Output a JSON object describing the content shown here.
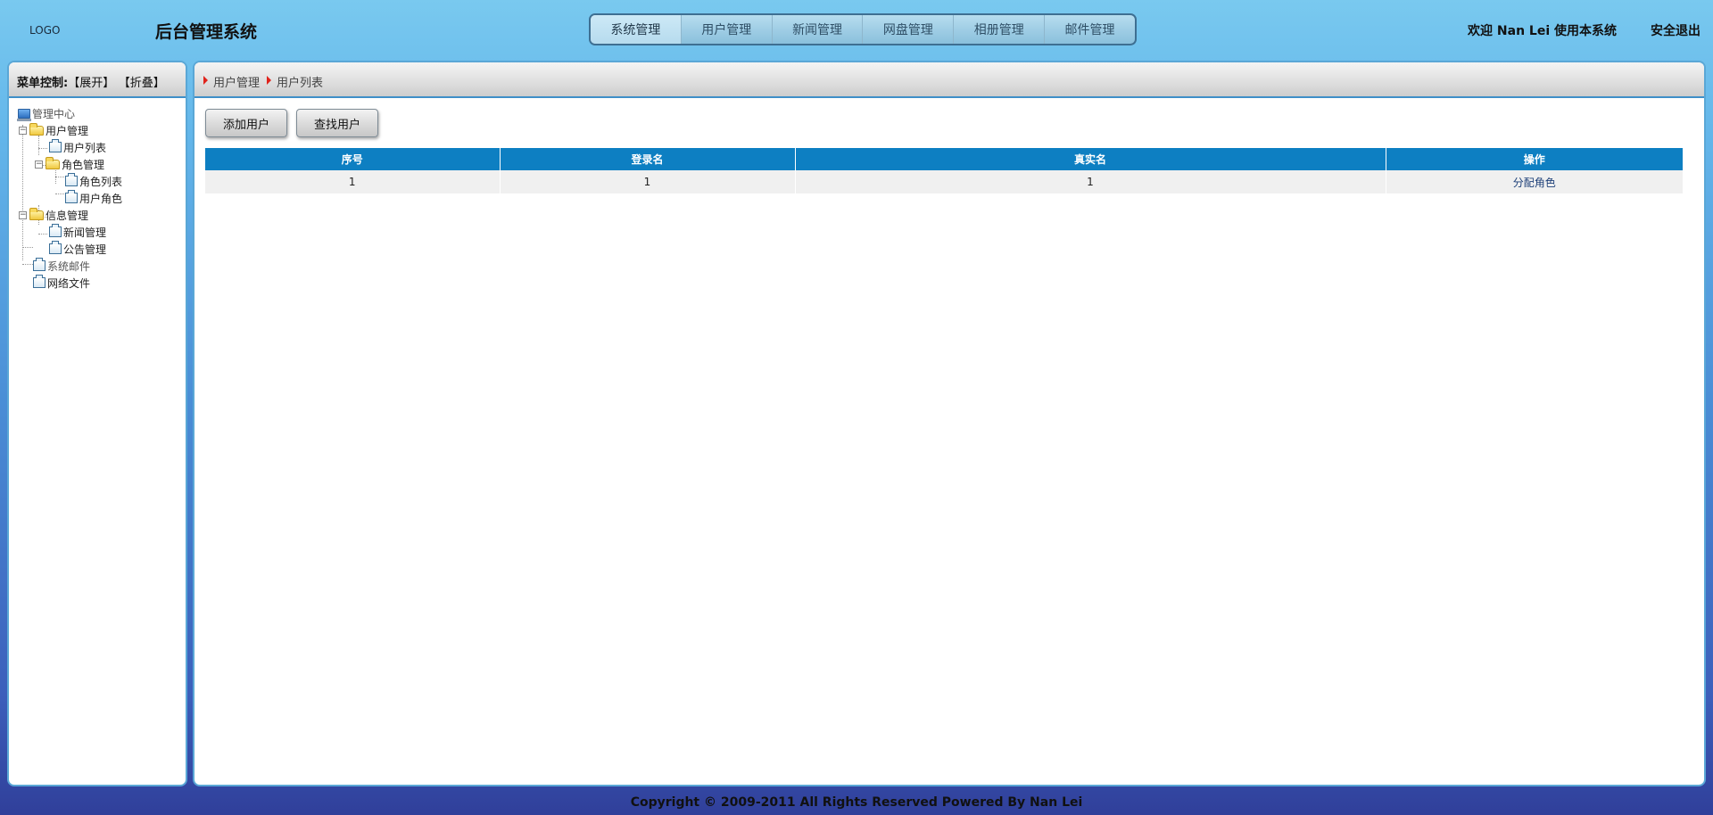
{
  "header": {
    "logo": "LOGO",
    "title": "后台管理系统",
    "welcome": "欢迎 Nan Lei 使用本系统",
    "logout": "安全退出"
  },
  "topnav": {
    "items": [
      "系统管理",
      "用户管理",
      "新闻管理",
      "网盘管理",
      "相册管理",
      "邮件管理"
    ],
    "active": "系统管理"
  },
  "sidebar": {
    "control_label": "菜单控制:",
    "expand": "【展开】",
    "collapse": "【折叠】",
    "tree": {
      "root": "管理中心",
      "user_mgmt": "用户管理",
      "user_list": "用户列表",
      "role_mgmt": "角色管理",
      "role_list": "角色列表",
      "user_role": "用户角色",
      "info_mgmt": "信息管理",
      "news_mgmt": "新闻管理",
      "notice_mgmt": "公告管理",
      "sys_mail": "系统邮件",
      "net_files": "网络文件"
    }
  },
  "breadcrumb": [
    "用户管理",
    "用户列表"
  ],
  "toolbar": {
    "add_user": "添加用户",
    "find_user": "查找用户"
  },
  "table": {
    "columns": [
      "序号",
      "登录名",
      "真实名",
      "操作"
    ],
    "rows": [
      {
        "index": "1",
        "login": "1",
        "realname": "1",
        "action": "分配角色"
      }
    ]
  },
  "footer": "Copyright © 2009-2011 All Rights Reserved Powered By Nan Lei",
  "colors": {
    "accent": "#0d7fc2",
    "frame_border": "#5aa7d6",
    "crumb_arrow": "#e0231b"
  }
}
